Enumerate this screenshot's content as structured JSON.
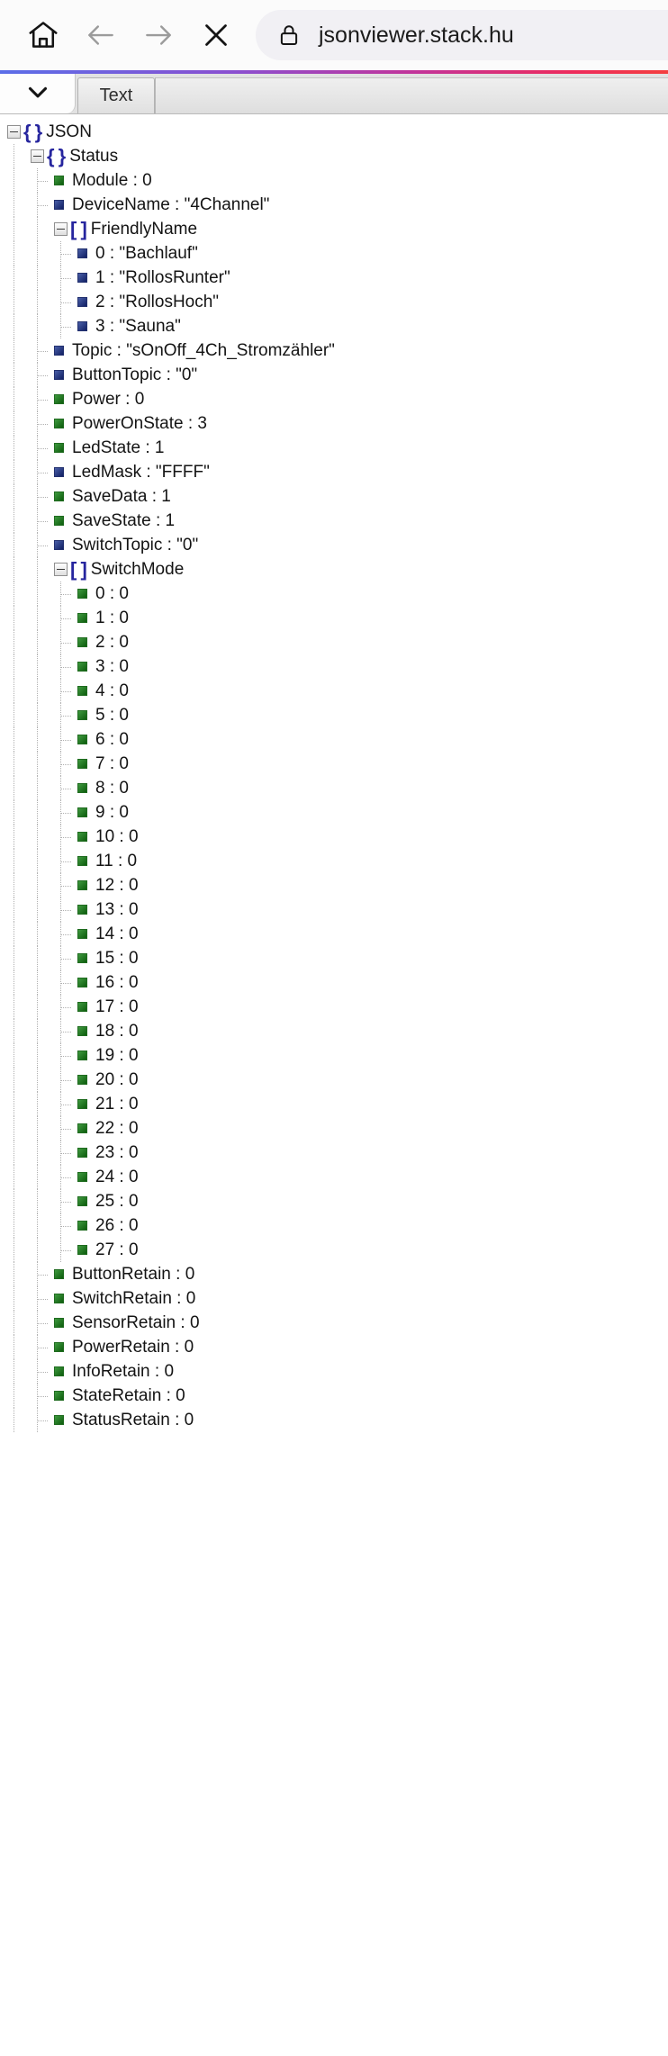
{
  "browser": {
    "home_label": "home-icon",
    "back_label": "back-arrow-icon",
    "forward_label": "forward-arrow-icon",
    "stop_label": "close-icon",
    "lock_label": "lock-icon",
    "url": "jsonviewer.stack.hu"
  },
  "tabstrip": {
    "collapse_label": "chevron-down-icon",
    "tabs": [
      {
        "label": "Text"
      }
    ]
  },
  "tree": {
    "nodes": [
      {
        "depth": 0,
        "kind": "object",
        "icon": "brace",
        "toggle": true,
        "text": "JSON"
      },
      {
        "depth": 1,
        "kind": "object",
        "icon": "brace",
        "toggle": true,
        "text": "Status"
      },
      {
        "depth": 2,
        "kind": "number",
        "icon": "green",
        "toggle": false,
        "text": "Module : 0"
      },
      {
        "depth": 2,
        "kind": "string",
        "icon": "blue",
        "toggle": false,
        "text": "DeviceName : \"4Channel\""
      },
      {
        "depth": 2,
        "kind": "array",
        "icon": "bracket",
        "toggle": true,
        "text": "FriendlyName"
      },
      {
        "depth": 3,
        "kind": "string",
        "icon": "blue",
        "toggle": false,
        "text": "0 : \"Bachlauf\""
      },
      {
        "depth": 3,
        "kind": "string",
        "icon": "blue",
        "toggle": false,
        "text": "1 : \"RollosRunter\""
      },
      {
        "depth": 3,
        "kind": "string",
        "icon": "blue",
        "toggle": false,
        "text": "2 : \"RollosHoch\""
      },
      {
        "depth": 3,
        "kind": "string",
        "icon": "blue",
        "toggle": false,
        "text": "3 : \"Sauna\""
      },
      {
        "depth": 2,
        "kind": "string",
        "icon": "blue",
        "toggle": false,
        "text": "Topic : \"sOnOff_4Ch_Stromzähler\""
      },
      {
        "depth": 2,
        "kind": "string",
        "icon": "blue",
        "toggle": false,
        "text": "ButtonTopic : \"0\""
      },
      {
        "depth": 2,
        "kind": "number",
        "icon": "green",
        "toggle": false,
        "text": "Power : 0"
      },
      {
        "depth": 2,
        "kind": "number",
        "icon": "green",
        "toggle": false,
        "text": "PowerOnState : 3"
      },
      {
        "depth": 2,
        "kind": "number",
        "icon": "green",
        "toggle": false,
        "text": "LedState : 1"
      },
      {
        "depth": 2,
        "kind": "string",
        "icon": "blue",
        "toggle": false,
        "text": "LedMask : \"FFFF\""
      },
      {
        "depth": 2,
        "kind": "number",
        "icon": "green",
        "toggle": false,
        "text": "SaveData : 1"
      },
      {
        "depth": 2,
        "kind": "number",
        "icon": "green",
        "toggle": false,
        "text": "SaveState : 1"
      },
      {
        "depth": 2,
        "kind": "string",
        "icon": "blue",
        "toggle": false,
        "text": "SwitchTopic : \"0\""
      },
      {
        "depth": 2,
        "kind": "array",
        "icon": "bracket",
        "toggle": true,
        "text": "SwitchMode"
      },
      {
        "depth": 3,
        "kind": "number",
        "icon": "green",
        "toggle": false,
        "text": "0 : 0"
      },
      {
        "depth": 3,
        "kind": "number",
        "icon": "green",
        "toggle": false,
        "text": "1 : 0"
      },
      {
        "depth": 3,
        "kind": "number",
        "icon": "green",
        "toggle": false,
        "text": "2 : 0"
      },
      {
        "depth": 3,
        "kind": "number",
        "icon": "green",
        "toggle": false,
        "text": "3 : 0"
      },
      {
        "depth": 3,
        "kind": "number",
        "icon": "green",
        "toggle": false,
        "text": "4 : 0"
      },
      {
        "depth": 3,
        "kind": "number",
        "icon": "green",
        "toggle": false,
        "text": "5 : 0"
      },
      {
        "depth": 3,
        "kind": "number",
        "icon": "green",
        "toggle": false,
        "text": "6 : 0"
      },
      {
        "depth": 3,
        "kind": "number",
        "icon": "green",
        "toggle": false,
        "text": "7 : 0"
      },
      {
        "depth": 3,
        "kind": "number",
        "icon": "green",
        "toggle": false,
        "text": "8 : 0"
      },
      {
        "depth": 3,
        "kind": "number",
        "icon": "green",
        "toggle": false,
        "text": "9 : 0"
      },
      {
        "depth": 3,
        "kind": "number",
        "icon": "green",
        "toggle": false,
        "text": "10 : 0"
      },
      {
        "depth": 3,
        "kind": "number",
        "icon": "green",
        "toggle": false,
        "text": "11 : 0"
      },
      {
        "depth": 3,
        "kind": "number",
        "icon": "green",
        "toggle": false,
        "text": "12 : 0"
      },
      {
        "depth": 3,
        "kind": "number",
        "icon": "green",
        "toggle": false,
        "text": "13 : 0"
      },
      {
        "depth": 3,
        "kind": "number",
        "icon": "green",
        "toggle": false,
        "text": "14 : 0"
      },
      {
        "depth": 3,
        "kind": "number",
        "icon": "green",
        "toggle": false,
        "text": "15 : 0"
      },
      {
        "depth": 3,
        "kind": "number",
        "icon": "green",
        "toggle": false,
        "text": "16 : 0"
      },
      {
        "depth": 3,
        "kind": "number",
        "icon": "green",
        "toggle": false,
        "text": "17 : 0"
      },
      {
        "depth": 3,
        "kind": "number",
        "icon": "green",
        "toggle": false,
        "text": "18 : 0"
      },
      {
        "depth": 3,
        "kind": "number",
        "icon": "green",
        "toggle": false,
        "text": "19 : 0"
      },
      {
        "depth": 3,
        "kind": "number",
        "icon": "green",
        "toggle": false,
        "text": "20 : 0"
      },
      {
        "depth": 3,
        "kind": "number",
        "icon": "green",
        "toggle": false,
        "text": "21 : 0"
      },
      {
        "depth": 3,
        "kind": "number",
        "icon": "green",
        "toggle": false,
        "text": "22 : 0"
      },
      {
        "depth": 3,
        "kind": "number",
        "icon": "green",
        "toggle": false,
        "text": "23 : 0"
      },
      {
        "depth": 3,
        "kind": "number",
        "icon": "green",
        "toggle": false,
        "text": "24 : 0"
      },
      {
        "depth": 3,
        "kind": "number",
        "icon": "green",
        "toggle": false,
        "text": "25 : 0"
      },
      {
        "depth": 3,
        "kind": "number",
        "icon": "green",
        "toggle": false,
        "text": "26 : 0"
      },
      {
        "depth": 3,
        "kind": "number",
        "icon": "green",
        "toggle": false,
        "text": "27 : 0"
      },
      {
        "depth": 2,
        "kind": "number",
        "icon": "green",
        "toggle": false,
        "text": "ButtonRetain : 0"
      },
      {
        "depth": 2,
        "kind": "number",
        "icon": "green",
        "toggle": false,
        "text": "SwitchRetain : 0"
      },
      {
        "depth": 2,
        "kind": "number",
        "icon": "green",
        "toggle": false,
        "text": "SensorRetain : 0"
      },
      {
        "depth": 2,
        "kind": "number",
        "icon": "green",
        "toggle": false,
        "text": "PowerRetain : 0"
      },
      {
        "depth": 2,
        "kind": "number",
        "icon": "green",
        "toggle": false,
        "text": "InfoRetain : 0"
      },
      {
        "depth": 2,
        "kind": "number",
        "icon": "green",
        "toggle": false,
        "text": "StateRetain : 0"
      },
      {
        "depth": 2,
        "kind": "number",
        "icon": "green",
        "toggle": false,
        "text": "StatusRetain : 0"
      }
    ]
  },
  "colors": {
    "brace": "#26259e",
    "green_node": "#1f6b1f",
    "blue_node": "#22306e",
    "progress_start": "#5b6ee8",
    "progress_end": "#f43f3f"
  }
}
